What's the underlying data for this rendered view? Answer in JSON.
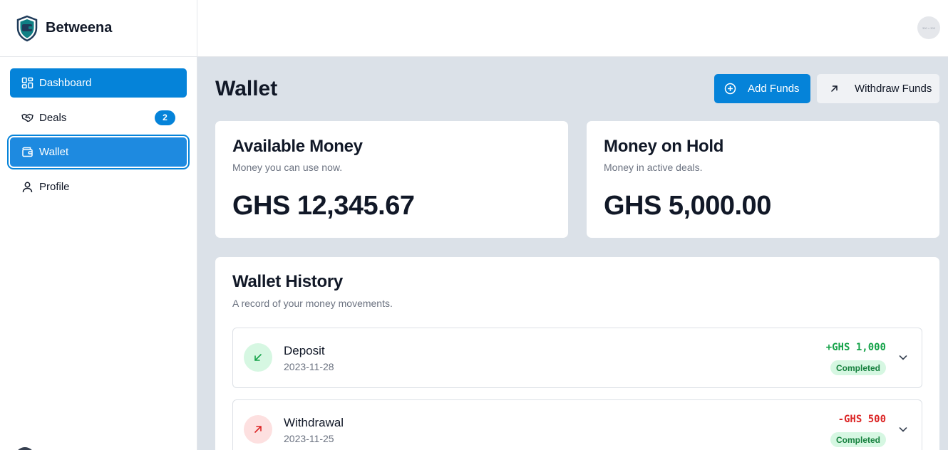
{
  "brand": {
    "name": "Betweena",
    "logo_icon": "shield-wallet-icon"
  },
  "sidebar": {
    "items": [
      {
        "label": "Dashboard",
        "icon": "dashboard-icon",
        "state": "active"
      },
      {
        "label": "Deals",
        "icon": "handshake-icon",
        "badge": "2"
      },
      {
        "label": "Wallet",
        "icon": "wallet-icon",
        "state": "focused"
      },
      {
        "label": "Profile",
        "icon": "user-icon"
      }
    ]
  },
  "topbar": {
    "avatar_text": "300 × 300"
  },
  "page": {
    "title": "Wallet"
  },
  "actions": {
    "add_funds": "Add Funds",
    "withdraw_funds": "Withdraw Funds"
  },
  "cards": {
    "available": {
      "title": "Available Money",
      "subtitle": "Money you can use now.",
      "amount": "GHS 12,345.67"
    },
    "hold": {
      "title": "Money on Hold",
      "subtitle": "Money in active deals.",
      "amount": "GHS 5,000.00"
    }
  },
  "history": {
    "title": "Wallet History",
    "subtitle": "A record of your money movements.",
    "transactions": [
      {
        "type": "Deposit",
        "date": "2023-11-28",
        "amount": "+GHS 1,000",
        "status": "Completed",
        "direction": "in"
      },
      {
        "type": "Withdrawal",
        "date": "2023-11-25",
        "amount": "-GHS 500",
        "status": "Completed",
        "direction": "out"
      }
    ]
  },
  "colors": {
    "accent": "#0583d9",
    "background": "#dbe1e8",
    "positive": "#16a34a",
    "negative": "#dc2626",
    "status_bg": "#d6f7e2"
  }
}
